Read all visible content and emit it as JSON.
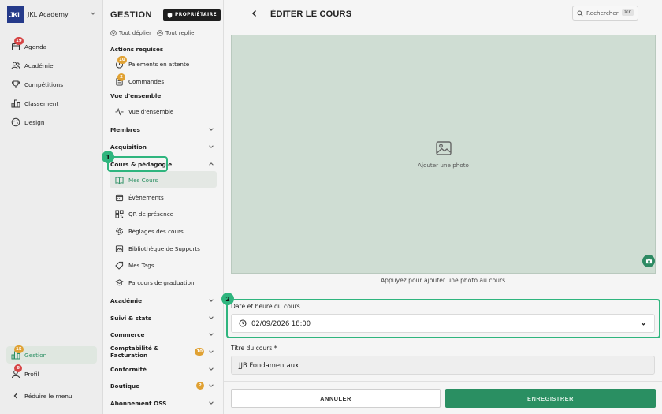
{
  "sidebar": {
    "logo_text": "JKL",
    "brand": "JKL Academy",
    "items": [
      {
        "label": "Agenda",
        "icon": "calendar-icon",
        "badge": "19"
      },
      {
        "label": "Académie",
        "icon": "users-icon",
        "badge": ""
      },
      {
        "label": "Compétitions",
        "icon": "trophy-icon",
        "badge": ""
      },
      {
        "label": "Classement",
        "icon": "ranking-icon",
        "badge": ""
      },
      {
        "label": "Design",
        "icon": "palette-icon",
        "badge": ""
      }
    ],
    "gestion": {
      "label": "Gestion",
      "badge": "15"
    },
    "profil": {
      "label": "Profil",
      "badge": "6"
    },
    "reduce": "Réduire le menu",
    "accent": "#2fb57e"
  },
  "panel": {
    "title": "GESTION",
    "owner_badge": "PROPRIÉTAIRE",
    "expand_all": "Tout déplier",
    "collapse_all": "Tout replier",
    "required_actions": "Actions requises",
    "required_items": [
      {
        "label": "Paiements en attente",
        "badge": "10"
      },
      {
        "label": "Commandes",
        "badge": "2"
      }
    ],
    "overview_section": "Vue d'ensemble",
    "overview_item": "Vue d'ensemble",
    "categories": [
      {
        "label": "Membres"
      },
      {
        "label": "Acquisition"
      },
      {
        "label": "Cours & pédagogie"
      }
    ],
    "course_items": [
      {
        "label": "Mes Cours",
        "icon": "book-icon"
      },
      {
        "label": "Évènements",
        "icon": "calendar-icon"
      },
      {
        "label": "QR de présence",
        "icon": "qr-icon"
      },
      {
        "label": "Réglages des cours",
        "icon": "settings-icon"
      },
      {
        "label": "Bibliothèque de Supports",
        "icon": "library-icon"
      },
      {
        "label": "Mes Tags",
        "icon": "tag-icon"
      },
      {
        "label": "Parcours de graduation",
        "icon": "graduation-icon"
      }
    ],
    "more_categories": [
      {
        "label": "Académie",
        "badge": ""
      },
      {
        "label": "Suivi & stats",
        "badge": ""
      },
      {
        "label": "Commerce",
        "badge": ""
      },
      {
        "label": "Comptabilité & Facturation",
        "badge": "10"
      },
      {
        "label": "Conformité",
        "badge": ""
      },
      {
        "label": "Boutique",
        "badge": "2"
      },
      {
        "label": "Abonnement OSS",
        "badge": ""
      }
    ],
    "highlight_1": "1"
  },
  "main": {
    "title": "ÉDITER LE COURS",
    "search_label": "Rechercher",
    "search_shortcut": "⌘K",
    "photo_label": "Ajouter une photo",
    "photo_caption": "Appuyez pour ajouter une photo au cours",
    "highlight_2": "2",
    "date_label": "Date et heure du cours",
    "date_value": "02/09/2026 18:00",
    "title_label": "Titre du cours *",
    "title_value": "JJB Fondamentaux",
    "cancel": "ANNULER",
    "save": "ENREGISTRER",
    "colors": {
      "photo_bg": "#cfddd3",
      "save_bg": "#2a8f62"
    }
  }
}
